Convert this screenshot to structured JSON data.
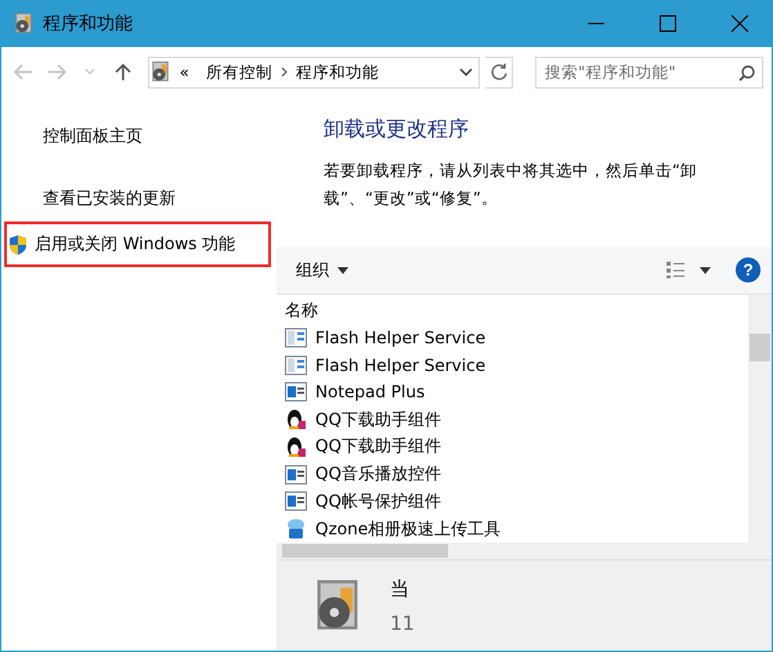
{
  "window": {
    "title": "程序和功能"
  },
  "address_bar": {
    "overflow": "«",
    "crumbs": [
      "所有控制",
      "程序和功能"
    ]
  },
  "search": {
    "placeholder": "搜索\"程序和功能\""
  },
  "sidebar": {
    "items": [
      {
        "label": "控制面板主页",
        "kind": "link",
        "highlighted": false
      },
      {
        "label": "查看已安装的更新",
        "kind": "link",
        "highlighted": false
      },
      {
        "label": "启用或关闭 Windows 功能",
        "kind": "shield",
        "highlighted": true
      }
    ]
  },
  "content": {
    "heading": "卸载或更改程序",
    "description": "若要卸载程序，请从列表中将其选中，然后单击“卸载”、“更改”或“修复”。"
  },
  "toolbar": {
    "organize": "组织",
    "help": "?"
  },
  "table": {
    "columns": [
      "名称"
    ],
    "rows": [
      {
        "name": "Flash Helper Service",
        "kind": "window"
      },
      {
        "name": "Flash Helper Service",
        "kind": "window"
      },
      {
        "name": "Notepad Plus",
        "kind": "app"
      },
      {
        "name": "QQ下载助手组件",
        "kind": "penguin"
      },
      {
        "name": "QQ下载助手组件",
        "kind": "penguin"
      },
      {
        "name": "QQ音乐播放控件",
        "kind": "app"
      },
      {
        "name": "QQ帐号保护组件",
        "kind": "app"
      },
      {
        "name": "Qzone相册极速上传工具",
        "kind": "upload"
      }
    ]
  },
  "details": {
    "line_1": "当",
    "line_2": "11"
  }
}
